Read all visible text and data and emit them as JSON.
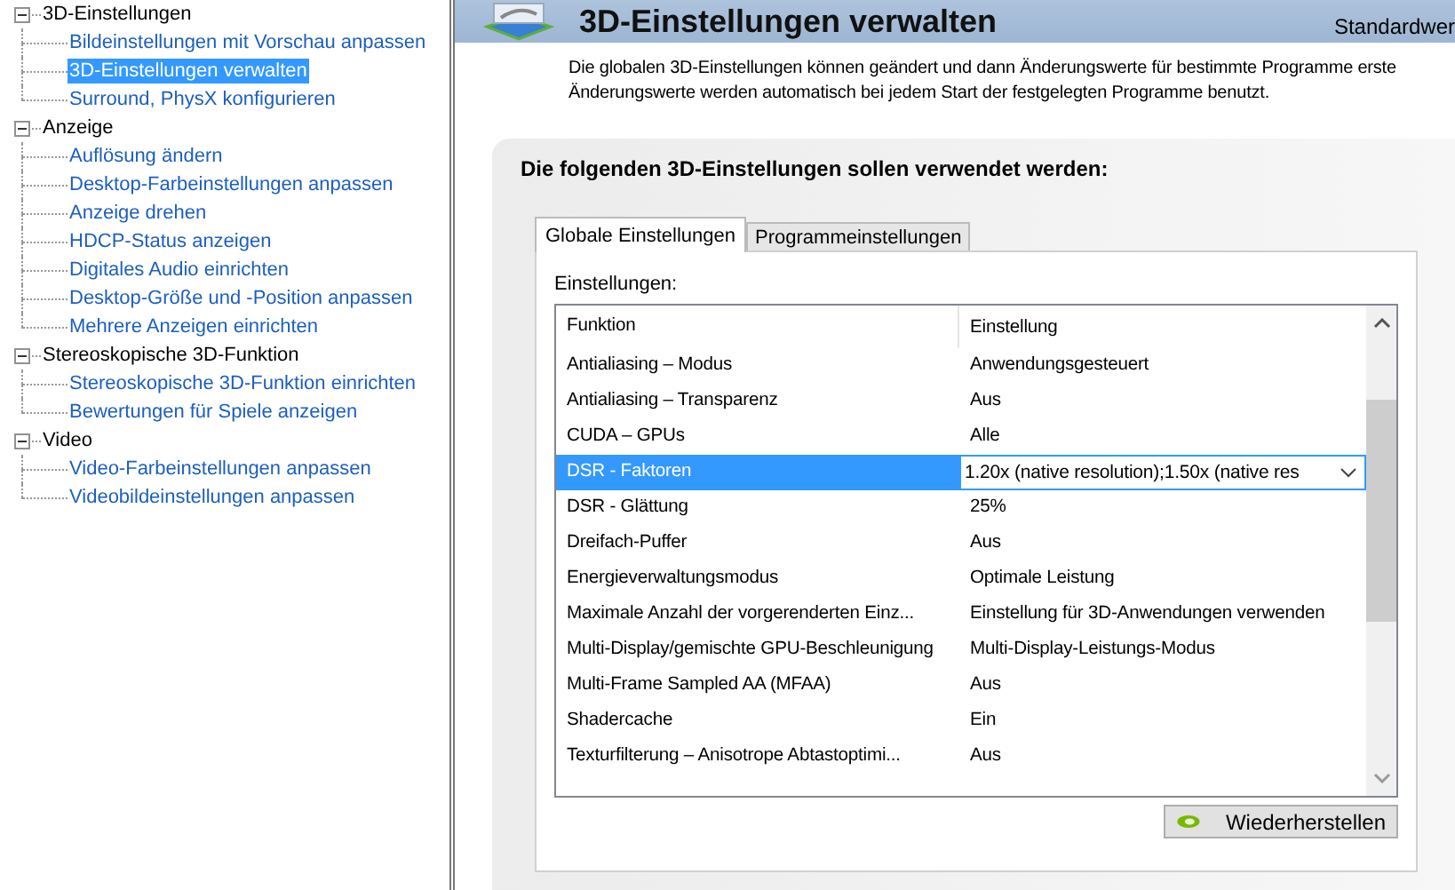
{
  "sidebar": {
    "tree": [
      {
        "label": "3D-Einstellungen",
        "expanded": true,
        "children": [
          {
            "label": "Bildeinstellungen mit Vorschau anpassen",
            "selected": false
          },
          {
            "label": "3D-Einstellungen verwalten",
            "selected": true
          },
          {
            "label": "Surround, PhysX konfigurieren",
            "selected": false
          }
        ]
      },
      {
        "label": "Anzeige",
        "expanded": true,
        "children": [
          {
            "label": "Auflösung ändern",
            "selected": false
          },
          {
            "label": "Desktop-Farbeinstellungen anpassen",
            "selected": false
          },
          {
            "label": "Anzeige drehen",
            "selected": false
          },
          {
            "label": "HDCP-Status anzeigen",
            "selected": false
          },
          {
            "label": "Digitales Audio einrichten",
            "selected": false
          },
          {
            "label": "Desktop-Größe und -Position anpassen",
            "selected": false
          },
          {
            "label": "Mehrere Anzeigen einrichten",
            "selected": false
          }
        ]
      },
      {
        "label": "Stereoskopische 3D-Funktion",
        "expanded": true,
        "children": [
          {
            "label": "Stereoskopische 3D-Funktion einrichten",
            "selected": false
          },
          {
            "label": "Bewertungen für Spiele anzeigen",
            "selected": false
          }
        ]
      },
      {
        "label": "Video",
        "expanded": true,
        "children": [
          {
            "label": "Video-Farbeinstellungen anpassen",
            "selected": false
          },
          {
            "label": "Videobildeinstellungen anpassen",
            "selected": false
          }
        ]
      }
    ]
  },
  "header": {
    "title": "3D-Einstellungen verwalten",
    "restore_defaults_link": "Standardwer"
  },
  "description": [
    "Die globalen 3D-Einstellungen können geändert und dann Änderungswerte für bestimmte Programme erste",
    "Änderungswerte werden automatisch bei jedem Start der festgelegten Programme benutzt."
  ],
  "panel": {
    "heading": "Die folgenden 3D-Einstellungen sollen verwendet werden:",
    "tabs": [
      {
        "label": "Globale Einstellungen",
        "selected": true
      },
      {
        "label": "Programmeinstellungen",
        "selected": false
      }
    ],
    "settings_label": "Einstellungen:",
    "table": {
      "columns": [
        "Funktion",
        "Einstellung"
      ],
      "rows": [
        {
          "function": "Antialiasing – Modus",
          "value": "Anwendungsgesteuert",
          "selected": false,
          "kind": "text"
        },
        {
          "function": "Antialiasing – Transparenz",
          "value": "Aus",
          "selected": false,
          "kind": "text"
        },
        {
          "function": "CUDA – GPUs",
          "value": "Alle",
          "selected": false,
          "kind": "text"
        },
        {
          "function": "DSR - Faktoren",
          "value": "1.20x (native resolution);1.50x (native res",
          "selected": true,
          "kind": "dropdown"
        },
        {
          "function": "DSR - Glättung",
          "value": "25%",
          "selected": false,
          "kind": "text"
        },
        {
          "function": "Dreifach-Puffer",
          "value": "Aus",
          "selected": false,
          "kind": "text"
        },
        {
          "function": "Energieverwaltungsmodus",
          "value": "Optimale Leistung",
          "selected": false,
          "kind": "text"
        },
        {
          "function": "Maximale Anzahl der vorgerenderten Einz...",
          "value": "Einstellung für 3D-Anwendungen verwenden",
          "selected": false,
          "kind": "text"
        },
        {
          "function": "Multi-Display/gemischte GPU-Beschleunigung",
          "value": "Multi-Display-Leistungs-Modus",
          "selected": false,
          "kind": "text"
        },
        {
          "function": "Multi-Frame Sampled AA (MFAA)",
          "value": "Aus",
          "selected": false,
          "kind": "text"
        },
        {
          "function": "Shadercache",
          "value": "Ein",
          "selected": false,
          "kind": "text"
        },
        {
          "function": "Texturfilterung – Anisotrope Abtastoptimi...",
          "value": "Aus",
          "selected": false,
          "kind": "text"
        }
      ]
    },
    "restore_button": "Wiederherstellen"
  }
}
